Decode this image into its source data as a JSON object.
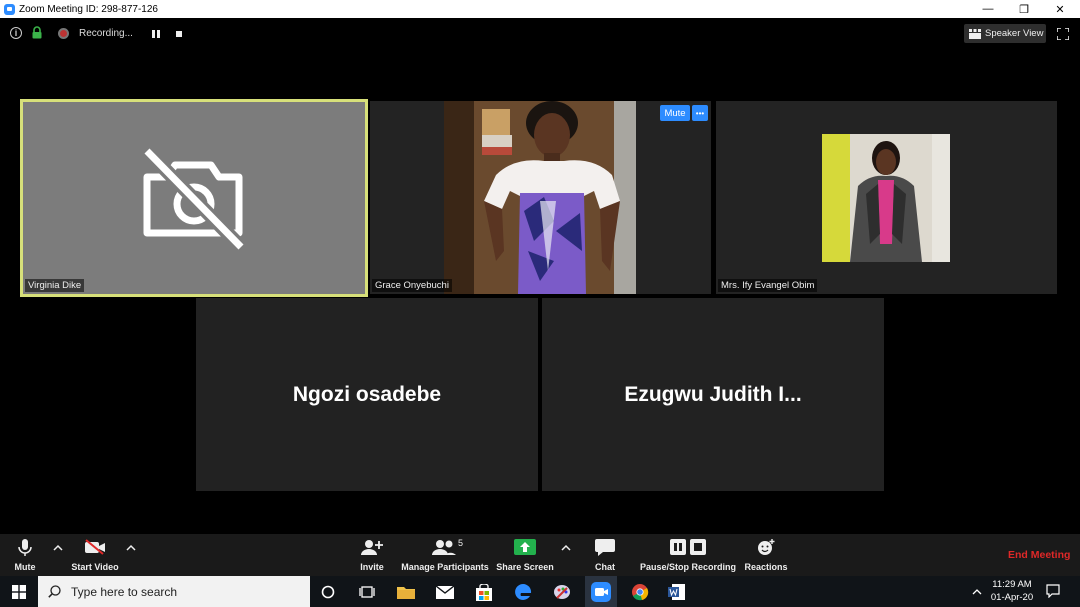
{
  "window": {
    "title": "Zoom Meeting ID: 298-877-126",
    "minimize": "—",
    "restore": "❐",
    "close": "✕"
  },
  "topbar": {
    "recording_label": "Recording...",
    "speaker_view_label": "Speaker View",
    "info_glyph": "i"
  },
  "participants": [
    {
      "name": "Virginia Dike",
      "video": "off",
      "active_speaker": true
    },
    {
      "name": "Grace Onyebuchi",
      "video": "on",
      "mute_label": "Mute",
      "more_label": "•••"
    },
    {
      "name": "Mrs. Ify Evangel Obim",
      "video": "on"
    },
    {
      "name": "Ngozi osadebe",
      "video": "off"
    },
    {
      "name": "Ezugwu Judith I...",
      "video": "off"
    }
  ],
  "toolbar": {
    "mute": "Mute",
    "start_video": "Start Video",
    "invite": "Invite",
    "manage_participants": "Manage Participants",
    "participant_count": "5",
    "share_screen": "Share Screen",
    "chat": "Chat",
    "pause_stop_recording": "Pause/Stop Recording",
    "reactions": "Reactions",
    "end_meeting": "End Meeting"
  },
  "taskbar": {
    "search_placeholder": "Type here to search",
    "time": "11:29 AM",
    "date": "01-Apr-20"
  },
  "colors": {
    "accent": "#2d8cff",
    "end_meeting": "#e02828",
    "active_border": "#d7e07a",
    "share_green": "#23b14d"
  }
}
